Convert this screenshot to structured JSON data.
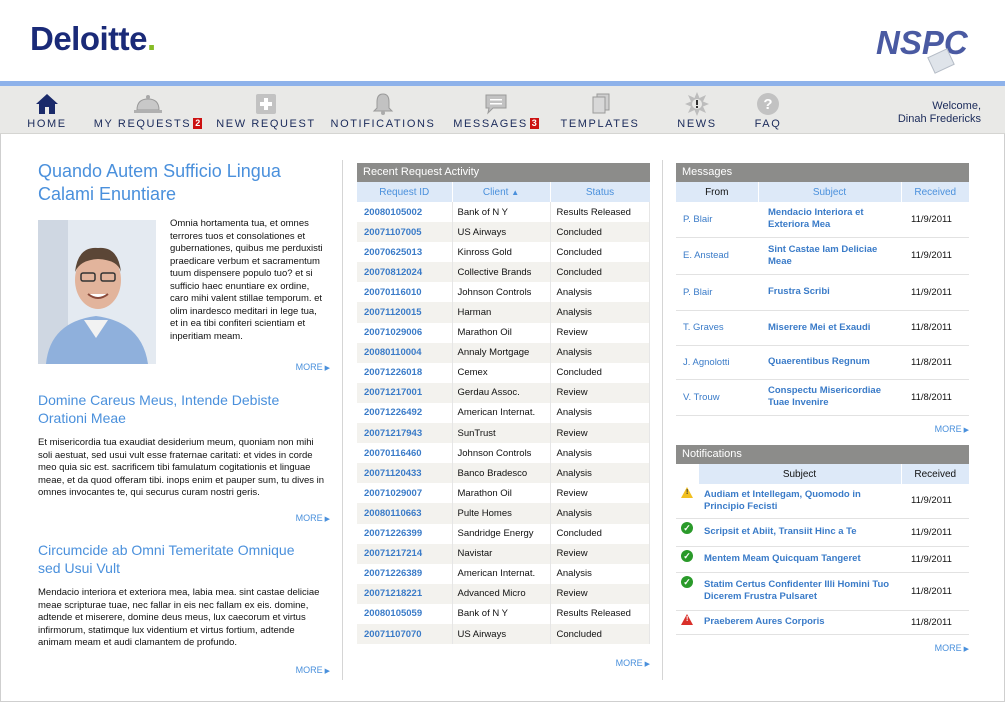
{
  "header": {
    "brand_left": "Deloitte",
    "brand_dot": ".",
    "brand_right": "NSPC"
  },
  "nav": {
    "items": [
      {
        "label": "HOME",
        "icon": "home-icon",
        "badge": ""
      },
      {
        "label": "MY REQUESTS",
        "icon": "bell-tray-icon",
        "badge": "2"
      },
      {
        "label": "NEW REQUEST",
        "icon": "plus-icon",
        "badge": ""
      },
      {
        "label": "NOTIFICATIONS",
        "icon": "bell-icon",
        "badge": ""
      },
      {
        "label": "MESSAGES",
        "icon": "message-icon",
        "badge": "3"
      },
      {
        "label": "TEMPLATES",
        "icon": "templates-icon",
        "badge": ""
      },
      {
        "label": "NEWS",
        "icon": "news-icon",
        "badge": ""
      },
      {
        "label": "FAQ",
        "icon": "question-icon",
        "badge": ""
      }
    ],
    "welcome": "Welcome,",
    "user": "Dinah Fredericks"
  },
  "articles": [
    {
      "title": "Quando Autem Sufficio Lingua Calami Enuntiare",
      "body": "Omnia hortamenta tua, et omnes terrores tuos et consolationes et gubernationes, quibus me perduxisti praedicare verbum et sacramentum tuum dispensere populo tuo? et si sufficio haec enuntiare ex ordine, caro mihi valent stillae temporum. et olim inardesco meditari in lege tua, et in ea tibi confiteri scientiam et inperitiam meam.",
      "more": "MORE"
    },
    {
      "title": "Domine Careus Meus, Intende Debiste Orationi Meae",
      "body": "Et misericordia tua exaudiat desiderium meum, quoniam non mihi soli aestuat, sed usui vult esse fraternae caritati: et vides in corde meo quia sic est. sacrificem tibi famulatum cogitationis et linguae meae, et da quod offeram tibi. inops enim et pauper sum, tu dives in omnes invocantes te, qui securus curam nostri geris.",
      "more": "MORE"
    },
    {
      "title": "Circumcide ab Omni Temeritate Omnique sed Usui Vult",
      "body": "Mendacio interiora et exteriora mea, labia mea. sint castae deliciae meae scripturae tuae, nec fallar in eis nec fallam ex eis. domine, adtende et miserere, domine deus meus, lux caecorum et virtus infirmorum, statimque lux videntium et virtus fortium, adtende animam meam et audi clamantem de profundo.",
      "more": "MORE"
    }
  ],
  "requests": {
    "title": "Recent Request Activity",
    "columns": [
      "Request ID",
      "Client",
      "Status"
    ],
    "rows": [
      [
        "20080105002",
        "Bank of N Y",
        "Results Released"
      ],
      [
        "20071107005",
        "US Airways",
        "Concluded"
      ],
      [
        "20070625013",
        "Kinross Gold",
        "Concluded"
      ],
      [
        "20070812024",
        "Collective Brands",
        "Concluded"
      ],
      [
        "20070116010",
        "Johnson Controls",
        "Analysis"
      ],
      [
        "20071120015",
        "Harman",
        "Analysis"
      ],
      [
        "20071029006",
        "Marathon Oil",
        "Review"
      ],
      [
        "20080110004",
        "Annaly Mortgage",
        "Analysis"
      ],
      [
        "20071226018",
        "Cemex",
        "Concluded"
      ],
      [
        "20071217001",
        "Gerdau Assoc.",
        "Review"
      ],
      [
        "20071226492",
        "American Internat.",
        "Analysis"
      ],
      [
        "20071217943",
        "SunTrust",
        "Review"
      ],
      [
        "20070116460",
        "Johnson Controls",
        "Analysis"
      ],
      [
        "20071120433",
        "Banco Bradesco",
        "Analysis"
      ],
      [
        "20071029007",
        "Marathon Oil",
        "Review"
      ],
      [
        "20080110663",
        "Pulte Homes",
        "Analysis"
      ],
      [
        "20071226399",
        "Sandridge Energy",
        "Concluded"
      ],
      [
        "20071217214",
        "Navistar",
        "Review"
      ],
      [
        "20071226389",
        "American Internat.",
        "Analysis"
      ],
      [
        "20071218221",
        "Advanced Micro",
        "Review"
      ],
      [
        "20080105059",
        "Bank of N Y",
        "Results Released"
      ],
      [
        "20071107070",
        "US Airways",
        "Concluded"
      ]
    ],
    "more": "MORE"
  },
  "messages": {
    "title": "Messages",
    "columns": [
      "From",
      "Subject",
      "Received"
    ],
    "rows": [
      [
        "P. Blair",
        "Mendacio Interiora et Exteriora Mea",
        "11/9/2011"
      ],
      [
        "E. Anstead",
        "Sint Castae Iam Deliciae Meae",
        "11/9/2011"
      ],
      [
        "P. Blair",
        "Frustra Scribi",
        "11/9/2011"
      ],
      [
        "T. Graves",
        "Miserere Mei et Exaudi",
        "11/8/2011"
      ],
      [
        "J. Agnolotti",
        "Quaerentibus Regnum",
        "11/8/2011"
      ],
      [
        "V. Trouw",
        "Conspectu Misericordiae Tuae Invenire",
        "11/8/2011"
      ]
    ],
    "more": "MORE"
  },
  "notifications": {
    "title": "Notifications",
    "columns": [
      "Subject",
      "Received"
    ],
    "rows": [
      {
        "icon": "warning-icon",
        "subject": "Audiam et Intellegam, Quomodo in Principio Fecisti",
        "received": "11/9/2011"
      },
      {
        "icon": "check-icon",
        "subject": "Scripsit et Abiit, Transiit Hinc a Te",
        "received": "11/9/2011"
      },
      {
        "icon": "check-icon",
        "subject": "Mentem Meam Quicquam Tangeret",
        "received": "11/9/2011"
      },
      {
        "icon": "check-icon",
        "subject": "Statim Certus Confidenter Illi Homini Tuo Dicerem Frustra Pulsaret",
        "received": "11/8/2011"
      },
      {
        "icon": "alert-icon",
        "subject": "Praeberem Aures Corporis",
        "received": "11/8/2011"
      }
    ],
    "more": "MORE"
  }
}
